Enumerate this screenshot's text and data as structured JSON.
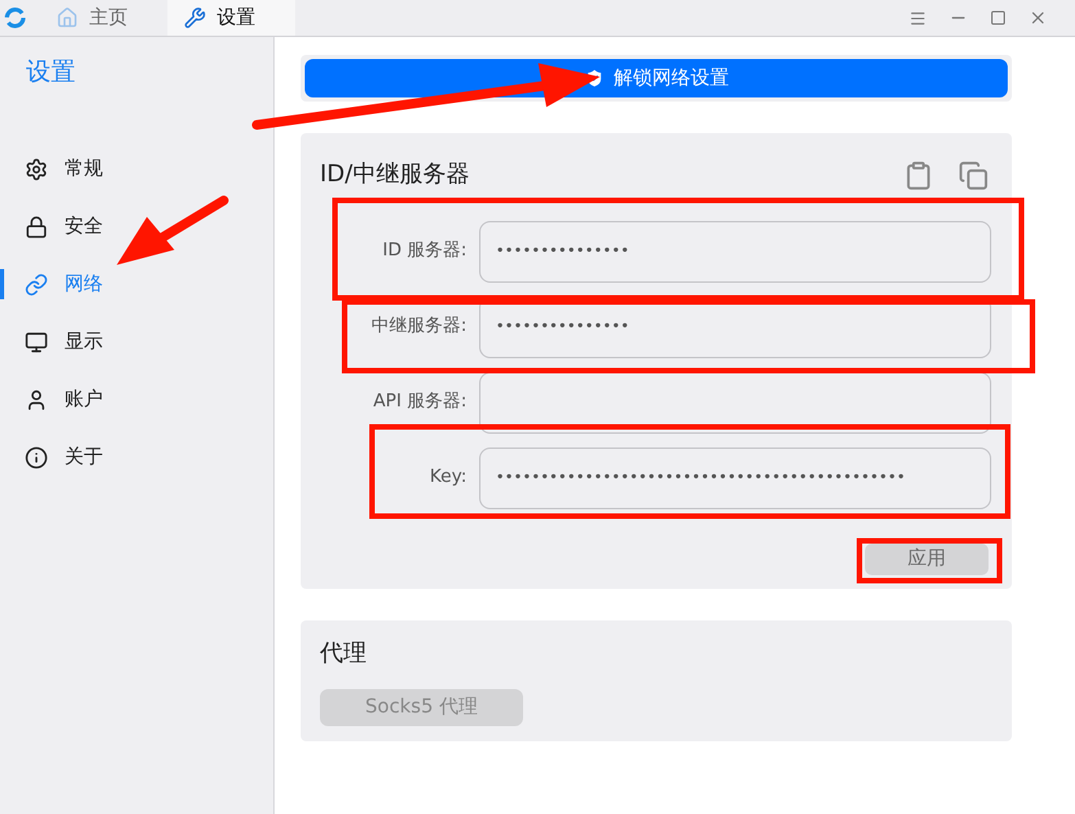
{
  "tabs": [
    {
      "label": "主页",
      "selected": false
    },
    {
      "label": "设置",
      "selected": true
    }
  ],
  "sidebar": {
    "title": "设置",
    "items": [
      {
        "label": "常规",
        "selected": false
      },
      {
        "label": "安全",
        "selected": false
      },
      {
        "label": "网络",
        "selected": true
      },
      {
        "label": "显示",
        "selected": false
      },
      {
        "label": "账户",
        "selected": false
      },
      {
        "label": "关于",
        "selected": false
      }
    ]
  },
  "unlock_button": {
    "label": "解锁网络设置"
  },
  "server_card": {
    "title": "ID/中继服务器",
    "fields": [
      {
        "label": "ID 服务器:",
        "value": "•••••••••••••••"
      },
      {
        "label": "中继服务器:",
        "value": "•••••••••••••••"
      },
      {
        "label": "API 服务器:"
      },
      {
        "label": "Key:",
        "value": "••••••••••••••••••••••••••••••••••••••••••••••"
      }
    ],
    "apply_button": {
      "label": "应用",
      "disabled": true
    }
  },
  "proxy_card": {
    "title": "代理",
    "button": {
      "label": "Socks5 代理",
      "disabled": true
    }
  }
}
